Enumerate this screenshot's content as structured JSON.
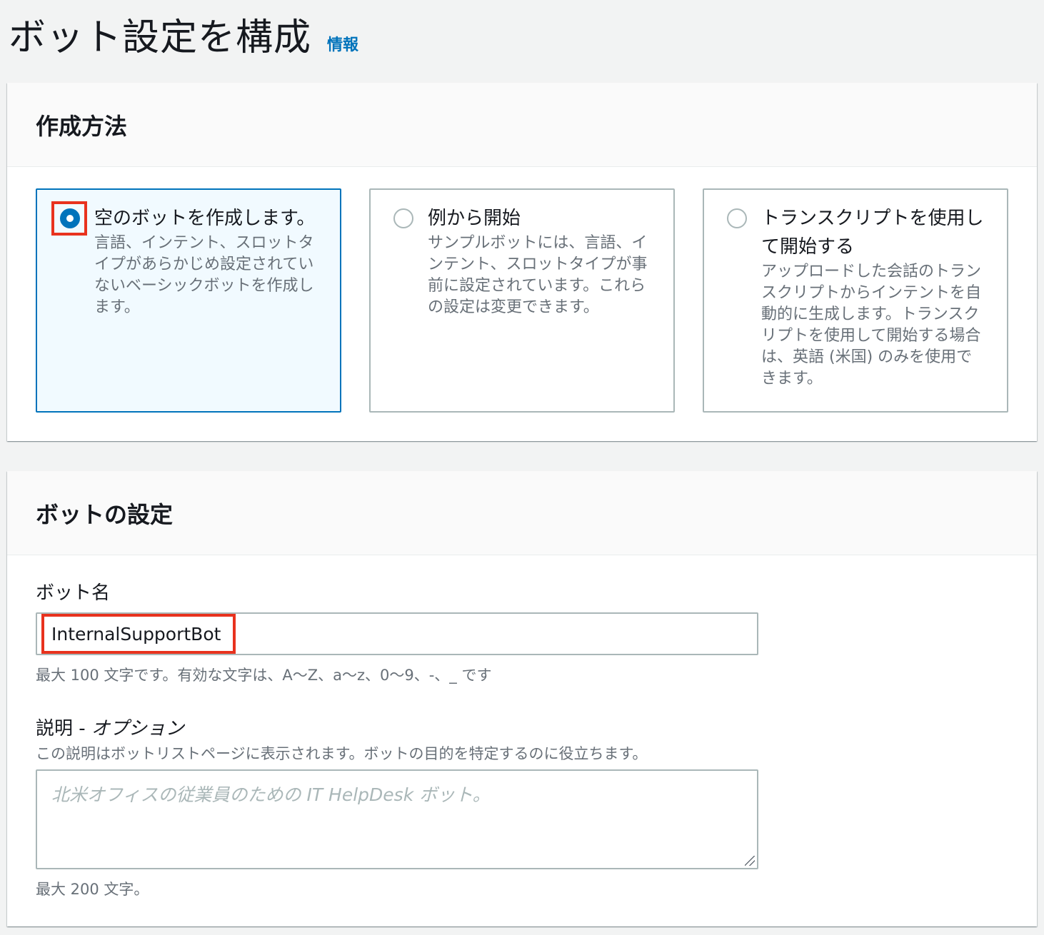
{
  "header": {
    "title": "ボット設定を構成",
    "info_link": "情報"
  },
  "creation_method": {
    "title": "作成方法",
    "options": [
      {
        "label": "空のボットを作成します。",
        "description": "言語、インテント、スロットタイプがあらかじめ設定されていないベーシックボットを作成します。",
        "selected": true
      },
      {
        "label": "例から開始",
        "description": "サンプルボットには、言語、インテント、スロットタイプが事前に設定されています。これらの設定は変更できます。",
        "selected": false
      },
      {
        "label": "トランスクリプトを使用して開始する",
        "description": "アップロードした会話のトランスクリプトからインテントを自動的に生成します。トランスクリプトを使用して開始する場合は、英語 (米国) のみを使用できます。",
        "selected": false
      }
    ]
  },
  "bot_settings": {
    "title": "ボットの設定",
    "name_label": "ボット名",
    "name_value": "InternalSupportBot",
    "name_hint": "最大 100 文字です。有効な文字は、A〜Z、a〜z、0〜9、-、_ です",
    "description_label": "説明 - ",
    "description_optional": "オプション",
    "description_help": "この説明はボットリストページに表示されます。ボットの目的を特定するのに役立ちます。",
    "description_placeholder": "北米オフィスの従業員のための IT HelpDesk ボット。",
    "description_hint": "最大 200 文字。"
  },
  "colors": {
    "accent": "#0073bb",
    "highlight": "#e8321e"
  }
}
